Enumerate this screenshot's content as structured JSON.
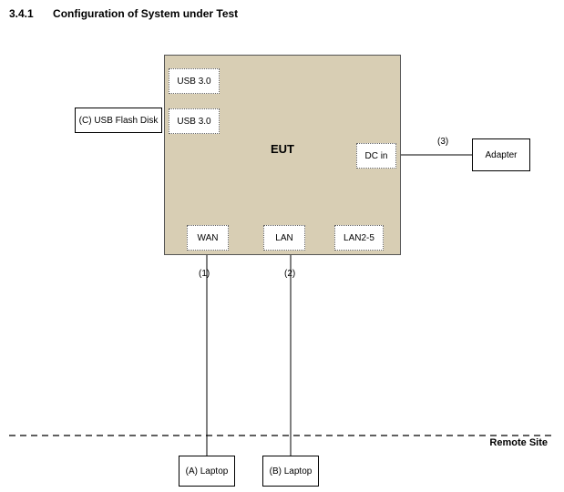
{
  "heading": {
    "number": "3.4.1",
    "title": "Configuration of System under Test"
  },
  "eut": {
    "label": "EUT",
    "color_bg": "#d8ceb4",
    "ports": {
      "usb_top": "USB 3.0",
      "usb_side": "USB 3.0",
      "dc_in": "DC in",
      "wan": "WAN",
      "lan": "LAN",
      "lan25": "LAN2-5"
    }
  },
  "external_devices": {
    "usb_flash": "(C) USB Flash Disk",
    "adapter": "Adapter",
    "laptop_a": "(A) Laptop",
    "laptop_b": "(B) Laptop"
  },
  "connection_labels": {
    "c1": "(1)",
    "c2": "(2)",
    "c3": "(3)"
  },
  "remote_site_label": "Remote Site"
}
